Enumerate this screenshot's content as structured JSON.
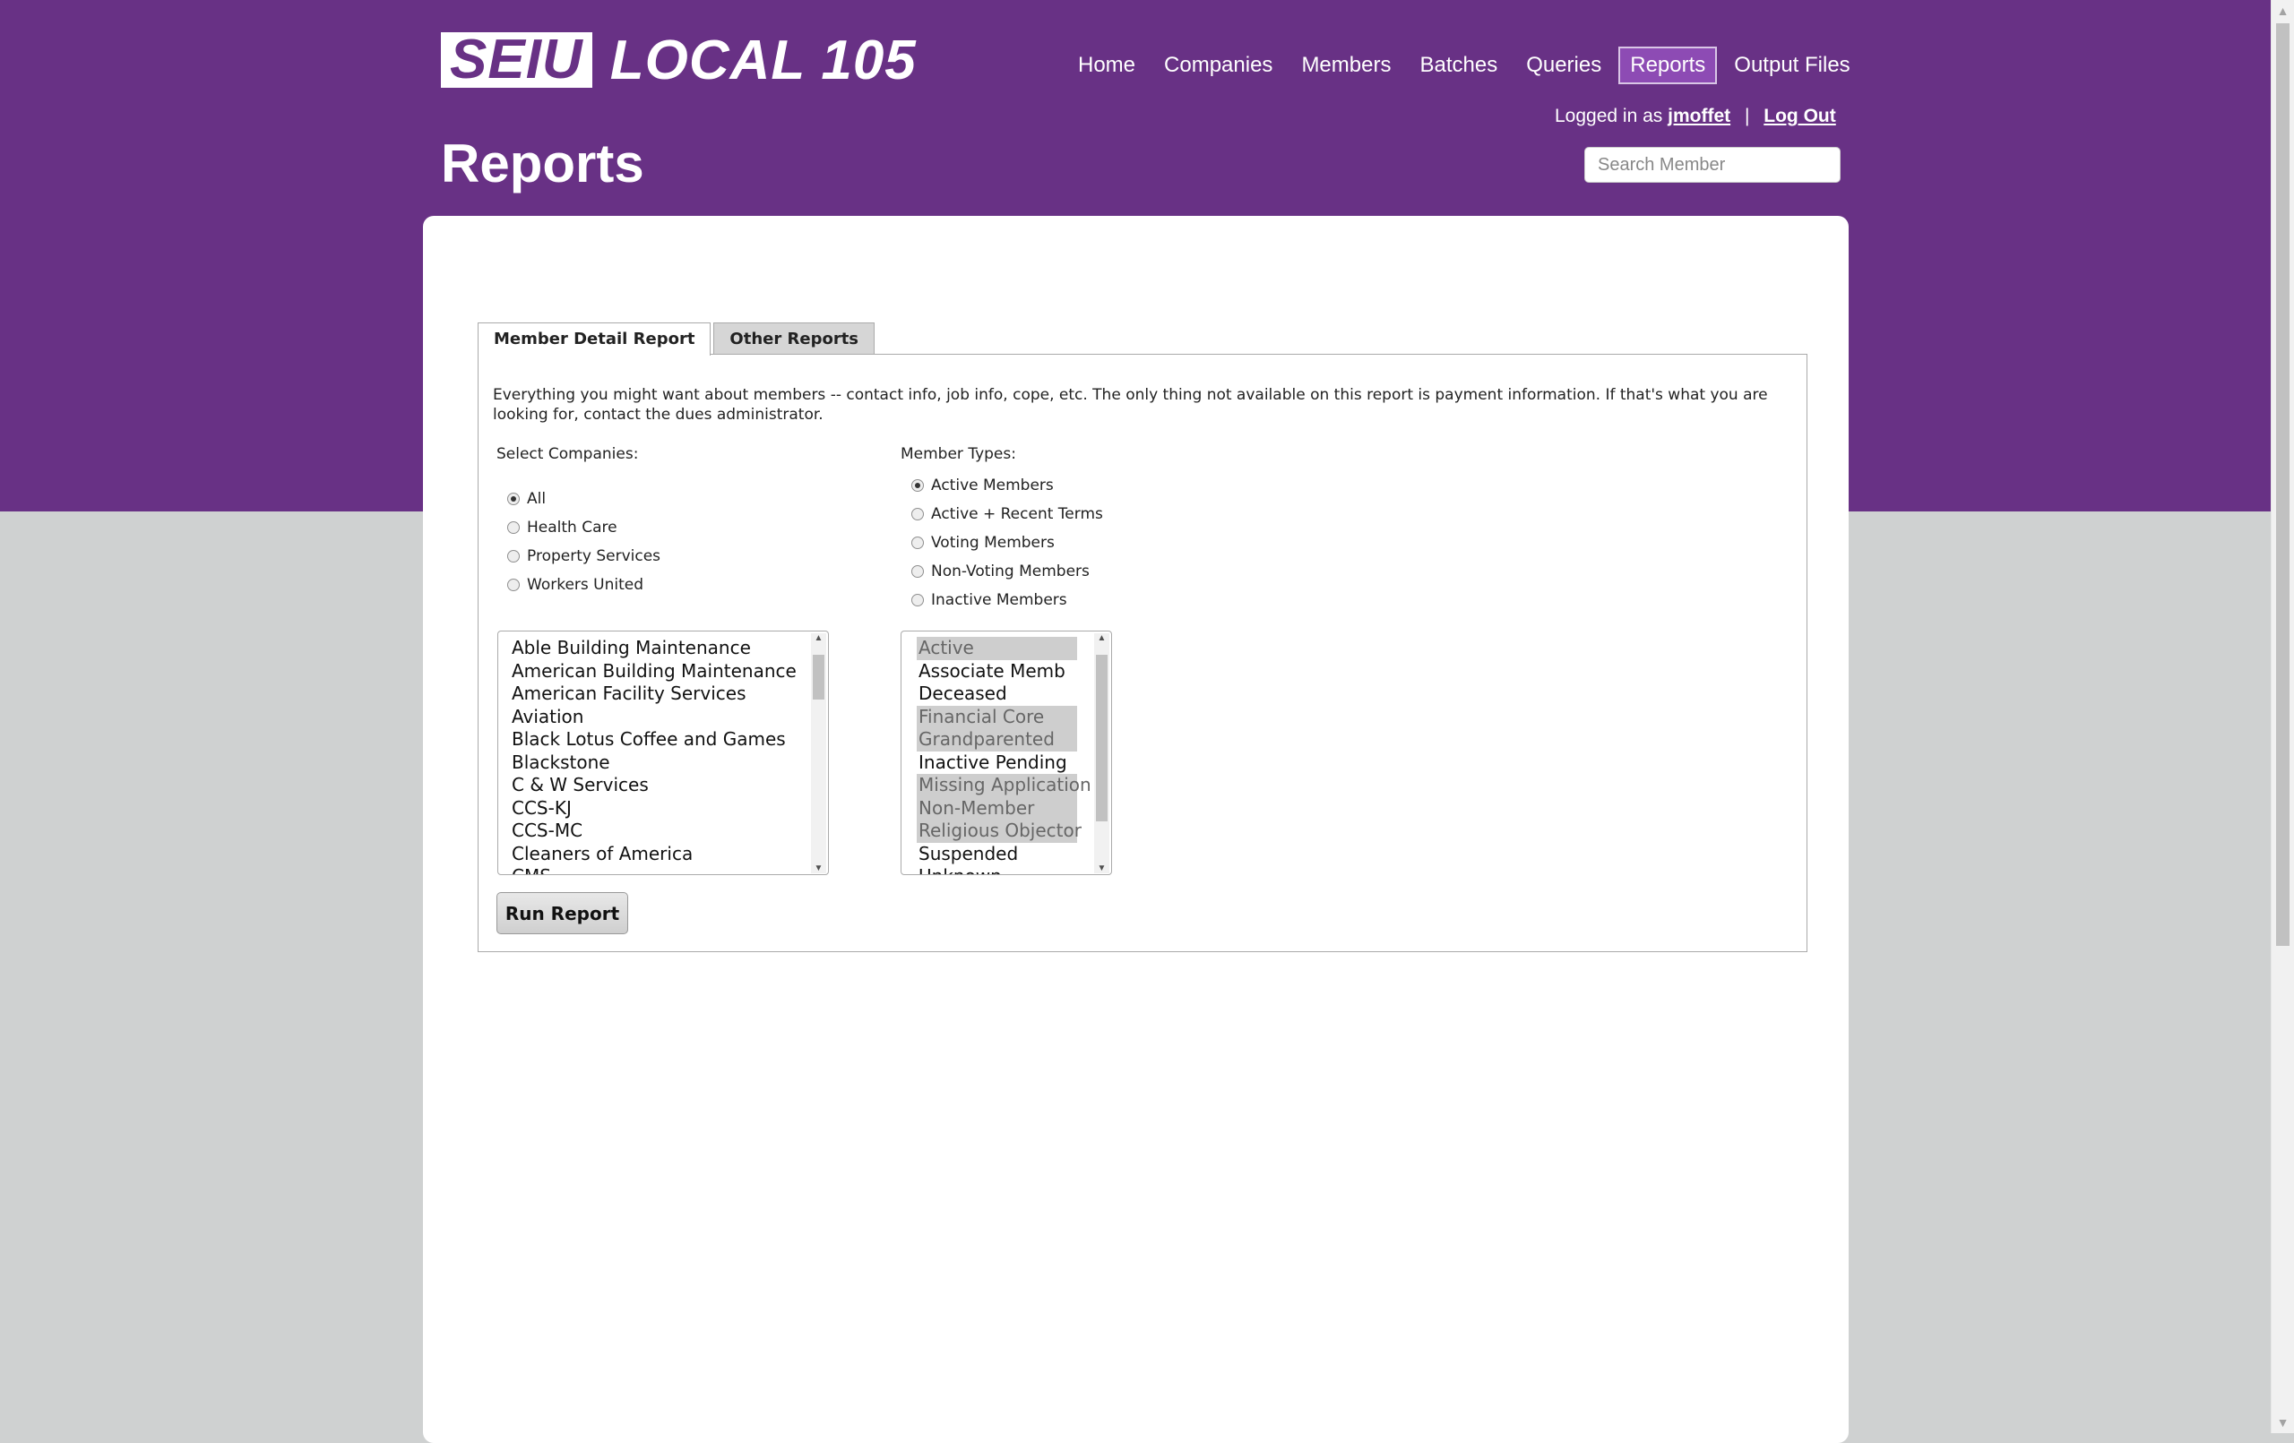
{
  "brand": {
    "seiu": "SEIU",
    "local": "LOCAL 105"
  },
  "nav": {
    "items": [
      {
        "label": "Home"
      },
      {
        "label": "Companies"
      },
      {
        "label": "Members"
      },
      {
        "label": "Batches"
      },
      {
        "label": "Queries"
      },
      {
        "label": "Reports",
        "active": true
      },
      {
        "label": "Output Files"
      }
    ]
  },
  "login": {
    "prefix": "Logged in as",
    "username": "jmoffet",
    "separator": "|",
    "logout": "Log Out"
  },
  "page": {
    "title": "Reports"
  },
  "search": {
    "placeholder": "Search Member",
    "value": ""
  },
  "tabs": [
    {
      "label": "Member Detail Report",
      "active": true
    },
    {
      "label": "Other Reports",
      "active": false
    }
  ],
  "report": {
    "description": "Everything you might want about members -- contact info, job info, cope, etc. The only thing not available on this report is payment information. If that's what you are looking for, contact the dues administrator.",
    "companies_label": "Select Companies:",
    "company_radios": [
      {
        "label": "All",
        "checked": true
      },
      {
        "label": "Health Care",
        "checked": false
      },
      {
        "label": "Property Services",
        "checked": false
      },
      {
        "label": "Workers United",
        "checked": false
      }
    ],
    "member_types_label": "Member Types:",
    "type_radios": [
      {
        "label": "Active Members",
        "checked": true
      },
      {
        "label": "Active + Recent Terms",
        "checked": false
      },
      {
        "label": "Voting Members",
        "checked": false
      },
      {
        "label": "Non-Voting Members",
        "checked": false
      },
      {
        "label": "Inactive Members",
        "checked": false
      }
    ],
    "companies": [
      "Able Building Maintenance",
      "American Building Maintenance",
      "American Facility Services",
      "Aviation",
      "Black Lotus Coffee and Games",
      "Blackstone",
      "C & W Services",
      "CCS-KJ",
      "CCS-MC",
      "Cleaners of America",
      "CMS"
    ],
    "member_statuses": [
      {
        "label": "Active",
        "selected": true
      },
      {
        "label": "Associate Memb",
        "selected": false
      },
      {
        "label": "Deceased",
        "selected": false
      },
      {
        "label": "Financial Core",
        "selected": true
      },
      {
        "label": "Grandparented",
        "selected": true
      },
      {
        "label": "Inactive Pending",
        "selected": false
      },
      {
        "label": "Missing Application",
        "selected": true
      },
      {
        "label": "Non-Member",
        "selected": true
      },
      {
        "label": "Religious Objector",
        "selected": true
      },
      {
        "label": "Suspended",
        "selected": false
      },
      {
        "label": "Unknown",
        "selected": false
      }
    ],
    "run_button": "Run Report"
  },
  "colors": {
    "header_purple": "#683185",
    "active_nav": "#8d4bb4",
    "page_grey": "#cfd1d1"
  }
}
